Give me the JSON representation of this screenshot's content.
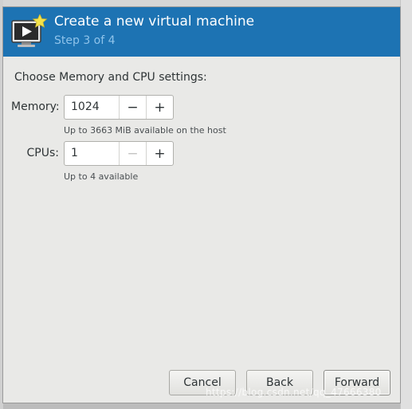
{
  "dialog": {
    "title": "Create a new virtual machine",
    "step": "Step 3 of 4",
    "accent_color": "#1d73b3"
  },
  "content": {
    "section_title": "Choose Memory and CPU settings:",
    "memory": {
      "label": "Memory:",
      "value": "1024",
      "decrement_symbol": "−",
      "increment_symbol": "+",
      "hint": "Up to 3663 MiB available on the host"
    },
    "cpus": {
      "label": "CPUs:",
      "value": "1",
      "decrement_symbol": "−",
      "increment_symbol": "+",
      "hint": "Up to 4 available"
    }
  },
  "footer": {
    "cancel_label": "Cancel",
    "back_label": "Back",
    "forward_label": "Forward"
  },
  "watermark": "https://blog.csdn.net/qq_47666380",
  "icons": [
    "new-vm-icon"
  ]
}
